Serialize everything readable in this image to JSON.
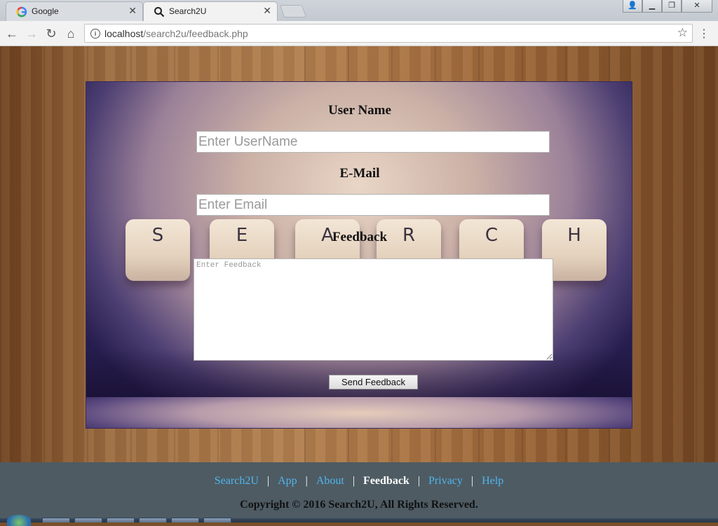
{
  "browser": {
    "tabs": [
      {
        "title": "Google"
      },
      {
        "title": "Search2U"
      }
    ],
    "url_host": "localhost",
    "url_path": "/search2u/feedback.php"
  },
  "form": {
    "username_label": "User Name",
    "username_placeholder": "Enter UserName",
    "email_label": "E-Mail",
    "email_placeholder": "Enter Email",
    "feedback_label": "Feedback",
    "feedback_placeholder": "Enter Feedback",
    "send_button": "Send Feedback"
  },
  "banner_keys": [
    "S",
    "E",
    "A",
    "R",
    "C",
    "H"
  ],
  "footer": {
    "links": [
      "Search2U",
      "App",
      "About",
      "Feedback",
      "Privacy",
      "Help"
    ],
    "current": "Feedback",
    "copyright": "Copyright © 2016 Search2U, All Rights Reserved."
  },
  "colors": {
    "footer_bg": "#4e5b63",
    "link": "#4fb6ee",
    "active_link": "#ffffff"
  }
}
